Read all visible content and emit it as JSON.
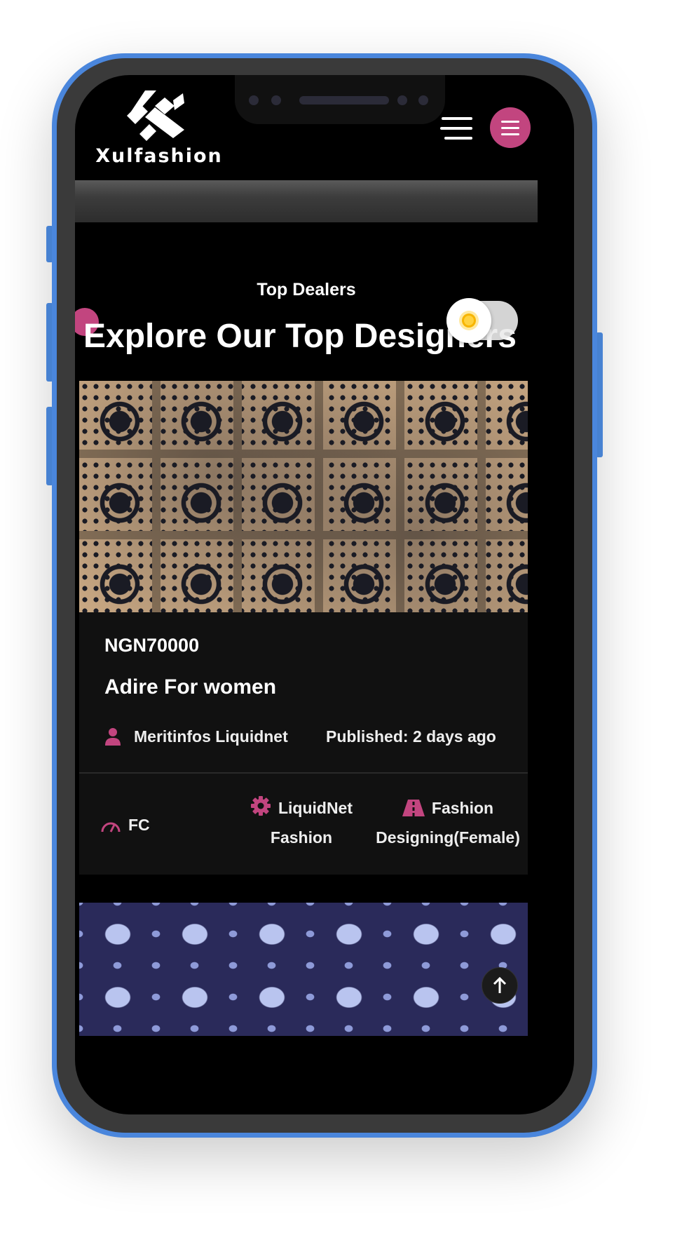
{
  "app": {
    "brand_name": "Xulfashion"
  },
  "header": {
    "menu_icon": "hamburger-icon",
    "menu_button_icon": "menu-icon"
  },
  "section": {
    "subtitle": "Top Dealers",
    "title": "Explore Our Top Designers",
    "theme_toggle_icon": "sun-icon"
  },
  "listing": {
    "price": "NGN70000",
    "title": "Adire For women",
    "author": "Meritinfos Liquidnet",
    "published": "Published: 2 days ago",
    "tags": [
      {
        "icon": "gauge-icon",
        "label": "FC"
      },
      {
        "icon": "gear-icon",
        "label_line1": "LiquidNet",
        "label_line2": "Fashion"
      },
      {
        "icon": "road-icon",
        "label_line1": "Fashion",
        "label_line2": "Designing(Female)"
      }
    ]
  },
  "scroll_top": {
    "icon": "arrow-up-icon"
  },
  "colors": {
    "accent": "#c2457f",
    "frame": "#4a86dc",
    "background": "#000000",
    "card": "#111111"
  }
}
